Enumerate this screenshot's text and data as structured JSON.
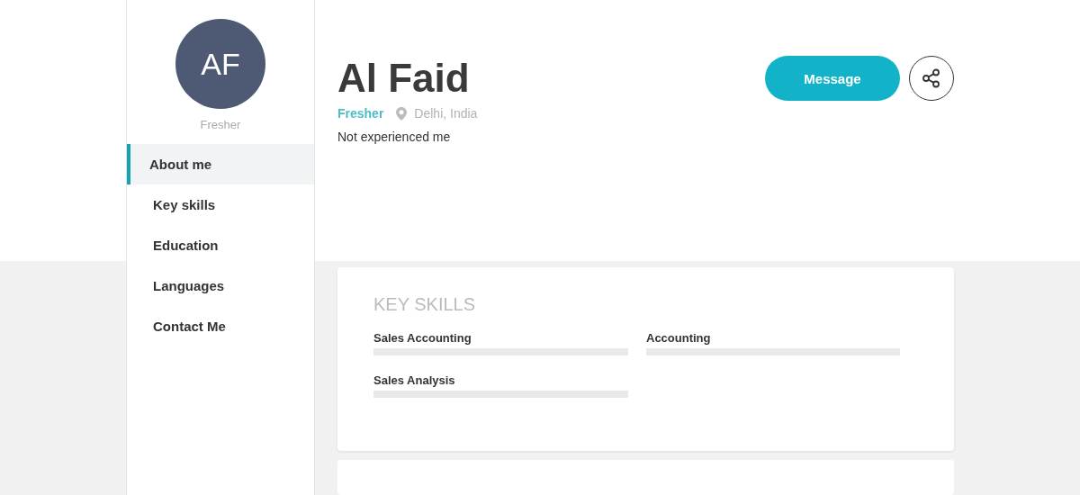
{
  "profile": {
    "initials": "AF",
    "avatar_caption": "Fresher",
    "name": "Al Faid",
    "status": "Fresher",
    "location": "Delhi, India",
    "bio": "Not experienced me"
  },
  "actions": {
    "message": "Message"
  },
  "sidebar": {
    "items": [
      {
        "label": "About me",
        "selected": true
      },
      {
        "label": "Key skills",
        "selected": false
      },
      {
        "label": "Education",
        "selected": false
      },
      {
        "label": "Languages",
        "selected": false
      },
      {
        "label": "Contact Me",
        "selected": false
      }
    ]
  },
  "key_skills": {
    "title": "KEY SKILLS",
    "skills": [
      {
        "name": "Sales Accounting",
        "level": 0
      },
      {
        "name": "Accounting",
        "level": 0
      },
      {
        "name": "Sales Analysis",
        "level": 0
      }
    ]
  }
}
